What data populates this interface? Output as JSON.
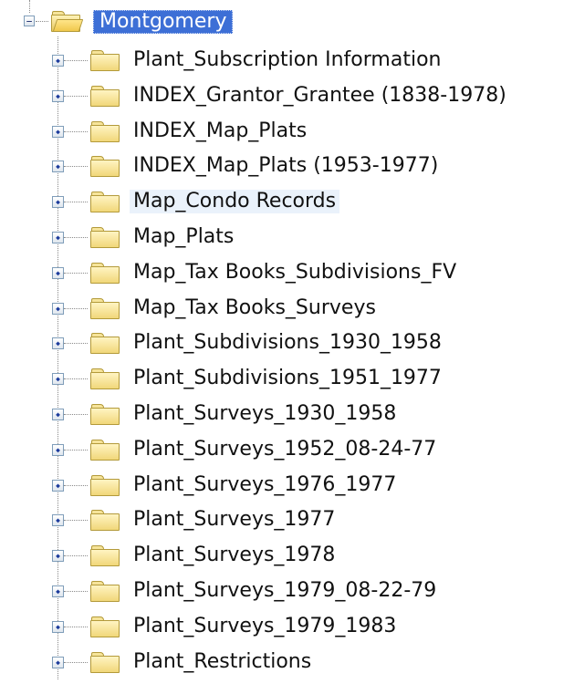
{
  "tree": {
    "root": {
      "label": "Montgomery",
      "expanded": true,
      "selected": true,
      "icon": "folder-open-icon"
    },
    "children": [
      {
        "label": "Plant_Subscription Information"
      },
      {
        "label": "INDEX_Grantor_Grantee (1838-1978)"
      },
      {
        "label": "INDEX_Map_Plats"
      },
      {
        "label": "INDEX_Map_Plats (1953-1977)"
      },
      {
        "label": "Map_Condo Records",
        "highlighted": true
      },
      {
        "label": "Map_Plats"
      },
      {
        "label": "Map_Tax Books_Subdivisions_FV"
      },
      {
        "label": "Map_Tax Books_Surveys"
      },
      {
        "label": "Plant_Subdivisions_1930_1958"
      },
      {
        "label": "Plant_Subdivisions_1951_1977"
      },
      {
        "label": "Plant_Surveys_1930_1958"
      },
      {
        "label": "Plant_Surveys_1952_08-24-77"
      },
      {
        "label": "Plant_Surveys_1976_1977"
      },
      {
        "label": "Plant_Surveys_1977"
      },
      {
        "label": "Plant_Surveys_1978"
      },
      {
        "label": "Plant_Surveys_1979_08-22-79"
      },
      {
        "label": "Plant_Surveys_1979_1983"
      },
      {
        "label": "Plant_Restrictions"
      }
    ],
    "icons": {
      "collapsed_expander": "expand-plus-icon",
      "expanded_expander": "collapse-minus-icon",
      "child_folder": "folder-icon"
    },
    "colors": {
      "selection": "#3d6fd6",
      "hover": "#eaf2fb",
      "folder_fill": "#f1d77a",
      "folder_border": "#b39a3a"
    }
  }
}
